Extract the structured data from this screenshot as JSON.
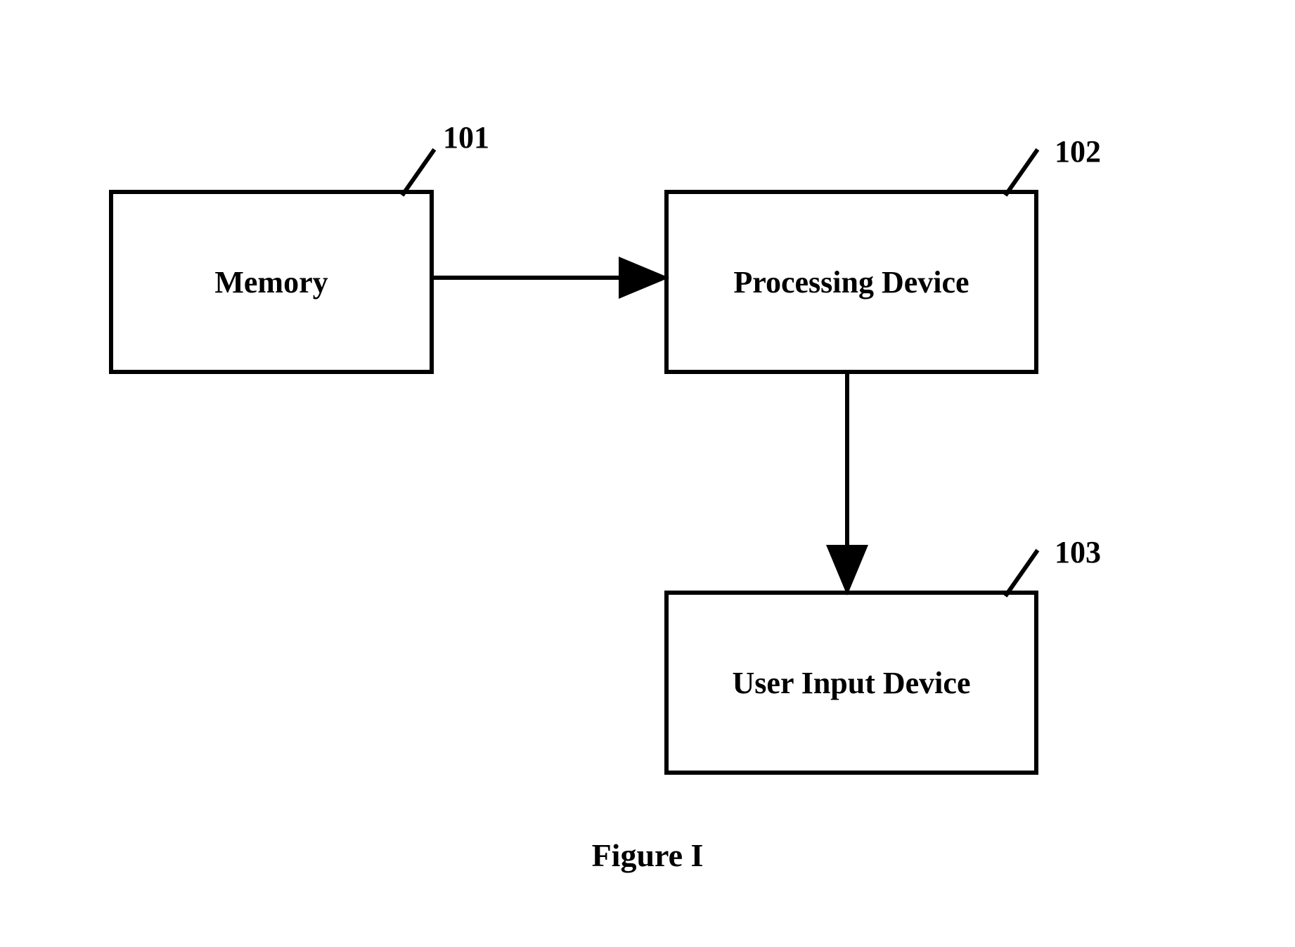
{
  "diagram": {
    "blocks": {
      "memory": {
        "label": "Memory",
        "ref": "101"
      },
      "processing": {
        "label": "Processing Device",
        "ref": "102"
      },
      "userinput": {
        "label": "User Input Device",
        "ref": "103"
      }
    },
    "caption": "Figure I"
  }
}
